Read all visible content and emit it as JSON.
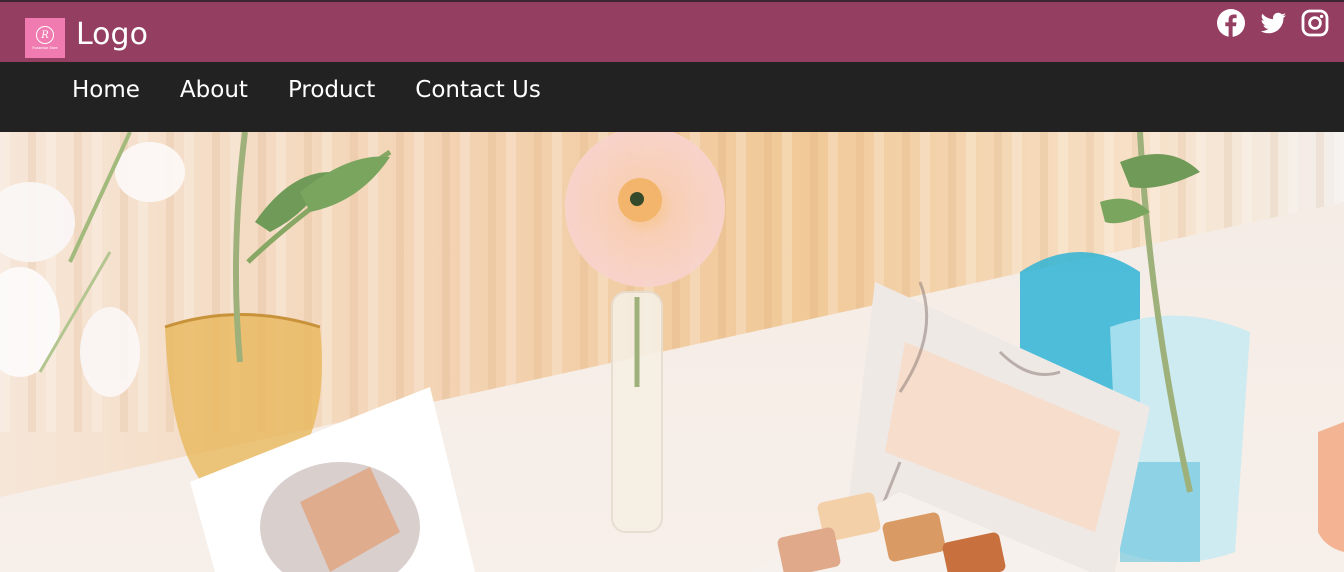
{
  "header": {
    "logo_badge_initial": "R",
    "logo_badge_text": "Rossmdar Store",
    "logo_text": "Logo",
    "social": [
      {
        "icon": "facebook-icon"
      },
      {
        "icon": "twitter-icon"
      },
      {
        "icon": "instagram-icon"
      }
    ]
  },
  "nav": {
    "items": [
      {
        "label": "Home"
      },
      {
        "label": "About"
      },
      {
        "label": "Product"
      },
      {
        "label": "Contact Us"
      }
    ]
  },
  "colors": {
    "topbar": "#943e62",
    "navbar": "#222222",
    "logo_badge": "#f07bb0"
  },
  "hero": {
    "image": "cosmetics-flatlay-photo"
  }
}
